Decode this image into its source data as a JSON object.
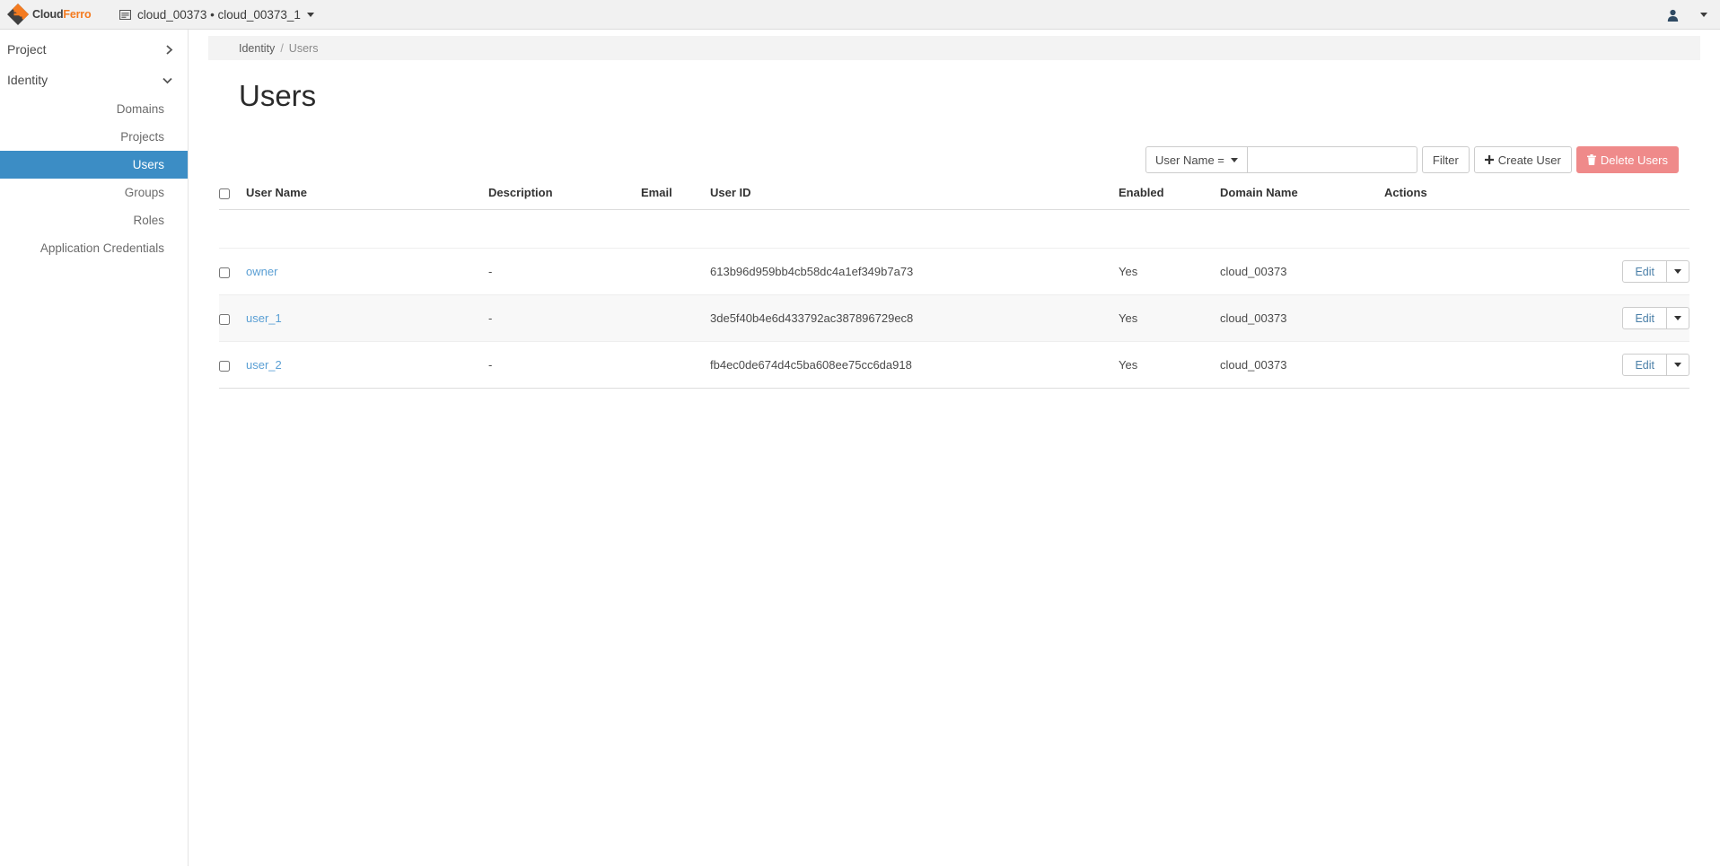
{
  "navbar": {
    "brand": {
      "name_part1": "Cloud",
      "name_part2": "Ferro",
      "logo_icon": "cloudferro-diamond-logo"
    },
    "context": {
      "icon": "project-card-icon",
      "label": "cloud_00373 • cloud_00373_1",
      "caret_icon": "caret-down-icon"
    },
    "user_menu": {
      "icon": "user-person-icon"
    },
    "settings_caret": {
      "icon": "caret-down-icon"
    }
  },
  "sidebar": {
    "groups": [
      {
        "label": "Project",
        "chevron_icon": "chevron-right-icon",
        "chevron": "›",
        "expanded": false
      },
      {
        "label": "Identity",
        "chevron_icon": "chevron-down-icon",
        "chevron": "⌄",
        "expanded": true
      }
    ],
    "items": [
      {
        "label": "Domains",
        "active": false
      },
      {
        "label": "Projects",
        "active": false
      },
      {
        "label": "Users",
        "active": true
      },
      {
        "label": "Groups",
        "active": false
      },
      {
        "label": "Roles",
        "active": false
      },
      {
        "label": "Application Credentials",
        "active": false
      }
    ]
  },
  "breadcrumb": {
    "parent": "Identity",
    "separator": "/",
    "current": "Users"
  },
  "page": {
    "title": "Users"
  },
  "toolbar": {
    "filter_select_label": "User Name =",
    "filter_select_caret": "caret-down-icon",
    "search_value": "",
    "search_placeholder": "",
    "filter_button": "Filter",
    "create_button": "Create User",
    "create_icon": "plus-icon",
    "create_icon_glyph": "➕",
    "delete_button": "Delete Users",
    "delete_icon": "trash-icon",
    "delete_icon_glyph": "🗑",
    "delete_color": "#ef8a8a"
  },
  "table": {
    "columns": [
      "User Name",
      "Description",
      "Email",
      "User ID",
      "Enabled",
      "Domain Name",
      "Actions"
    ],
    "select_all_checkbox": "select-all",
    "row_action_edit": "Edit",
    "row_action_caret": "caret-down-icon",
    "rows": [
      {
        "user_name": "owner",
        "description": "-",
        "email": "",
        "user_id": "613b96d959bb4cb58dc4a1ef349b7a73",
        "enabled": "Yes",
        "domain_name": "cloud_00373"
      },
      {
        "user_name": "user_1",
        "description": "-",
        "email": "",
        "user_id": "3de5f40b4e6d433792ac387896729ec8",
        "enabled": "Yes",
        "domain_name": "cloud_00373"
      },
      {
        "user_name": "user_2",
        "description": "-",
        "email": "",
        "user_id": "fb4ec0de674d4c5ba608ee75cc6da918",
        "enabled": "Yes",
        "domain_name": "cloud_00373"
      }
    ]
  },
  "colors": {
    "accent_blue": "#3c8dc5",
    "link_blue": "#5a9fd4",
    "brand_orange": "#f47b20",
    "danger": "#ef8a8a",
    "navbar_bg": "#f1f1f1"
  }
}
